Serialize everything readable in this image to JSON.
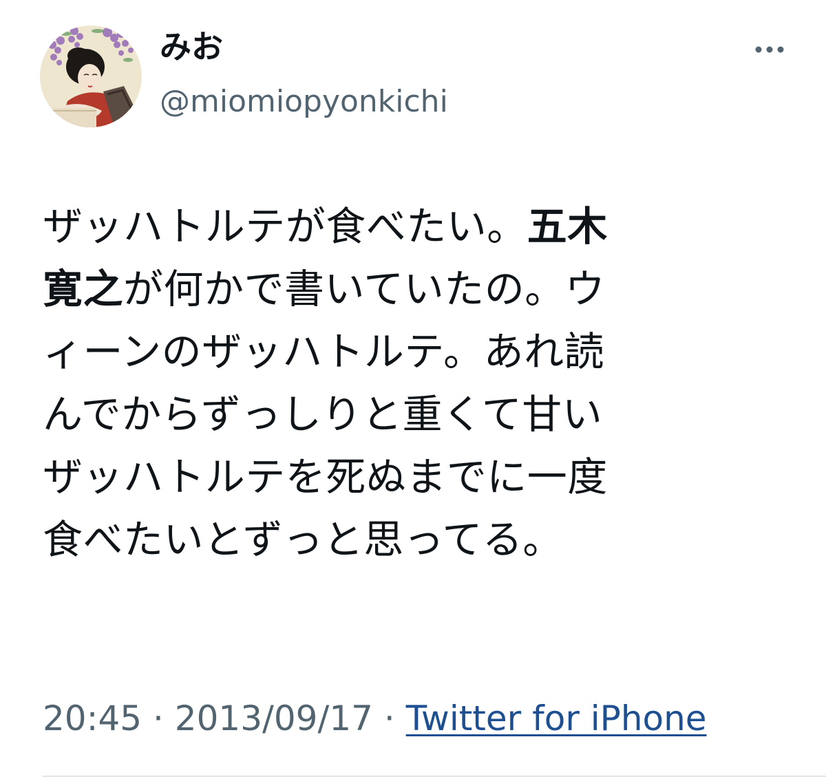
{
  "author": {
    "display_name": "みお",
    "handle": "@miomiopyonkichi",
    "avatar_icon": "profile-illustration-avatar"
  },
  "more_icon": "ellipsis-icon",
  "tweet": {
    "lines": [
      {
        "pre": "ザッハトルテが食べたい。",
        "bold": "五木",
        "post": ""
      },
      {
        "pre": "",
        "bold": "寛之",
        "post": "が何かで書いていたの。ウ"
      },
      {
        "pre": "ィーンのザッハトルテ。あれ読",
        "bold": "",
        "post": ""
      },
      {
        "pre": "んでからずっしりと重くて甘い",
        "bold": "",
        "post": ""
      },
      {
        "pre": "ザッハトルテを死ぬまでに一度",
        "bold": "",
        "post": ""
      },
      {
        "pre": "食べたいとずっと思ってる。",
        "bold": "",
        "post": ""
      }
    ]
  },
  "meta": {
    "time": "20:45",
    "separator": " · ",
    "date": "2013/09/17",
    "source": "Twitter for iPhone"
  },
  "colors": {
    "text": "#0f1419",
    "secondary": "#536471",
    "link": "#1d4f91"
  }
}
